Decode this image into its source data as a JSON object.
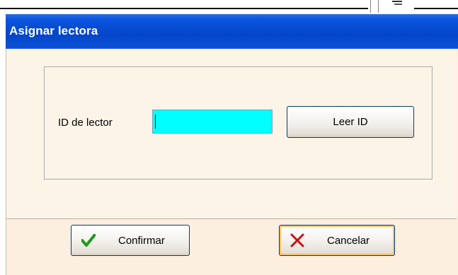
{
  "dialog": {
    "title": "Asignar lectora"
  },
  "form": {
    "reader_id_label": "ID de lector",
    "reader_id_value": "",
    "read_id_button": "Leer ID"
  },
  "actions": {
    "confirm_label": "Confirmar",
    "cancel_label": "Cancelar"
  },
  "colors": {
    "titlebar": "#0446c8",
    "input_background": "#00ffff",
    "dialog_background": "#fdf3e5",
    "confirm_icon": "#1a9a1a",
    "cancel_icon": "#cc1010"
  },
  "icons": {
    "confirm": "check-icon",
    "cancel": "x-icon"
  }
}
